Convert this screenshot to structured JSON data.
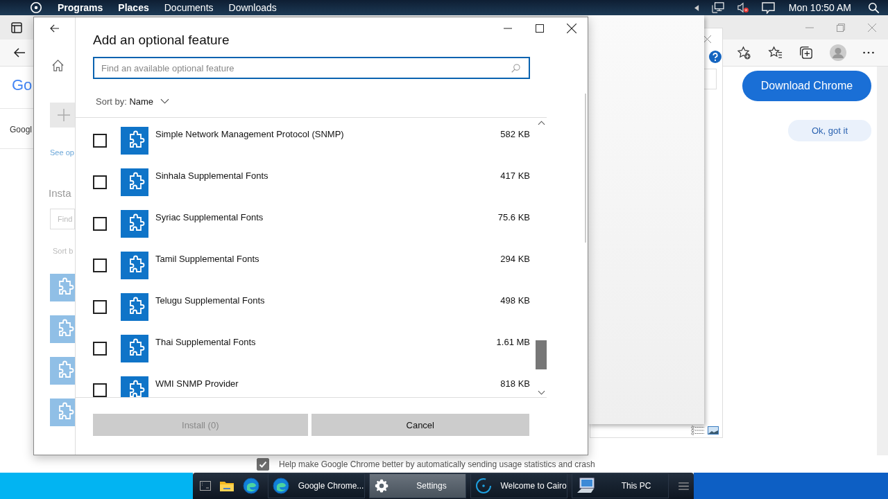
{
  "top_bar": {
    "menu": [
      {
        "label": "Programs",
        "bold": true
      },
      {
        "label": "Places",
        "bold": true
      },
      {
        "label": "Documents",
        "bold": false
      },
      {
        "label": "Downloads",
        "bold": false
      }
    ],
    "clock": "Mon 10:50 AM"
  },
  "browser": {
    "logo": "Go",
    "snippet": "Googl",
    "download_button": "Download Chrome",
    "ok_button": "Ok, got it",
    "consent": {
      "checked": true,
      "text": "Help make Google Chrome better by automatically sending usage statistics and crash"
    }
  },
  "settings_window": {
    "link": "See op",
    "heading": "Insta",
    "find_placeholder": "Find",
    "sort_label": "Sort b"
  },
  "dialog": {
    "title": "Add an optional feature",
    "search": {
      "placeholder": "Find an available optional feature"
    },
    "sort": {
      "label": "Sort by:",
      "value": "Name"
    },
    "features": [
      {
        "name": "Simple Network Management Protocol (SNMP)",
        "size": "582 KB",
        "checked": false
      },
      {
        "name": "Sinhala Supplemental Fonts",
        "size": "417 KB",
        "checked": false
      },
      {
        "name": "Syriac Supplemental Fonts",
        "size": "75.6 KB",
        "checked": false
      },
      {
        "name": "Tamil Supplemental Fonts",
        "size": "294 KB",
        "checked": false
      },
      {
        "name": "Telugu Supplemental Fonts",
        "size": "498 KB",
        "checked": false
      },
      {
        "name": "Thai Supplemental Fonts",
        "size": "1.61 MB",
        "checked": false
      },
      {
        "name": "WMI SNMP Provider",
        "size": "818 KB",
        "checked": false
      }
    ],
    "buttons": [
      {
        "label": "Install (0)",
        "disabled": true
      },
      {
        "label": "Cancel",
        "disabled": false
      }
    ]
  },
  "taskbar": {
    "items": [
      {
        "label": "Google Chrome...",
        "kind": "browser",
        "selected": false
      },
      {
        "label": "Settings",
        "kind": "settings",
        "selected": true
      },
      {
        "label": "Welcome to Cairo",
        "kind": "welcome",
        "selected": false
      },
      {
        "label": "This PC",
        "kind": "computer",
        "selected": false
      }
    ]
  }
}
